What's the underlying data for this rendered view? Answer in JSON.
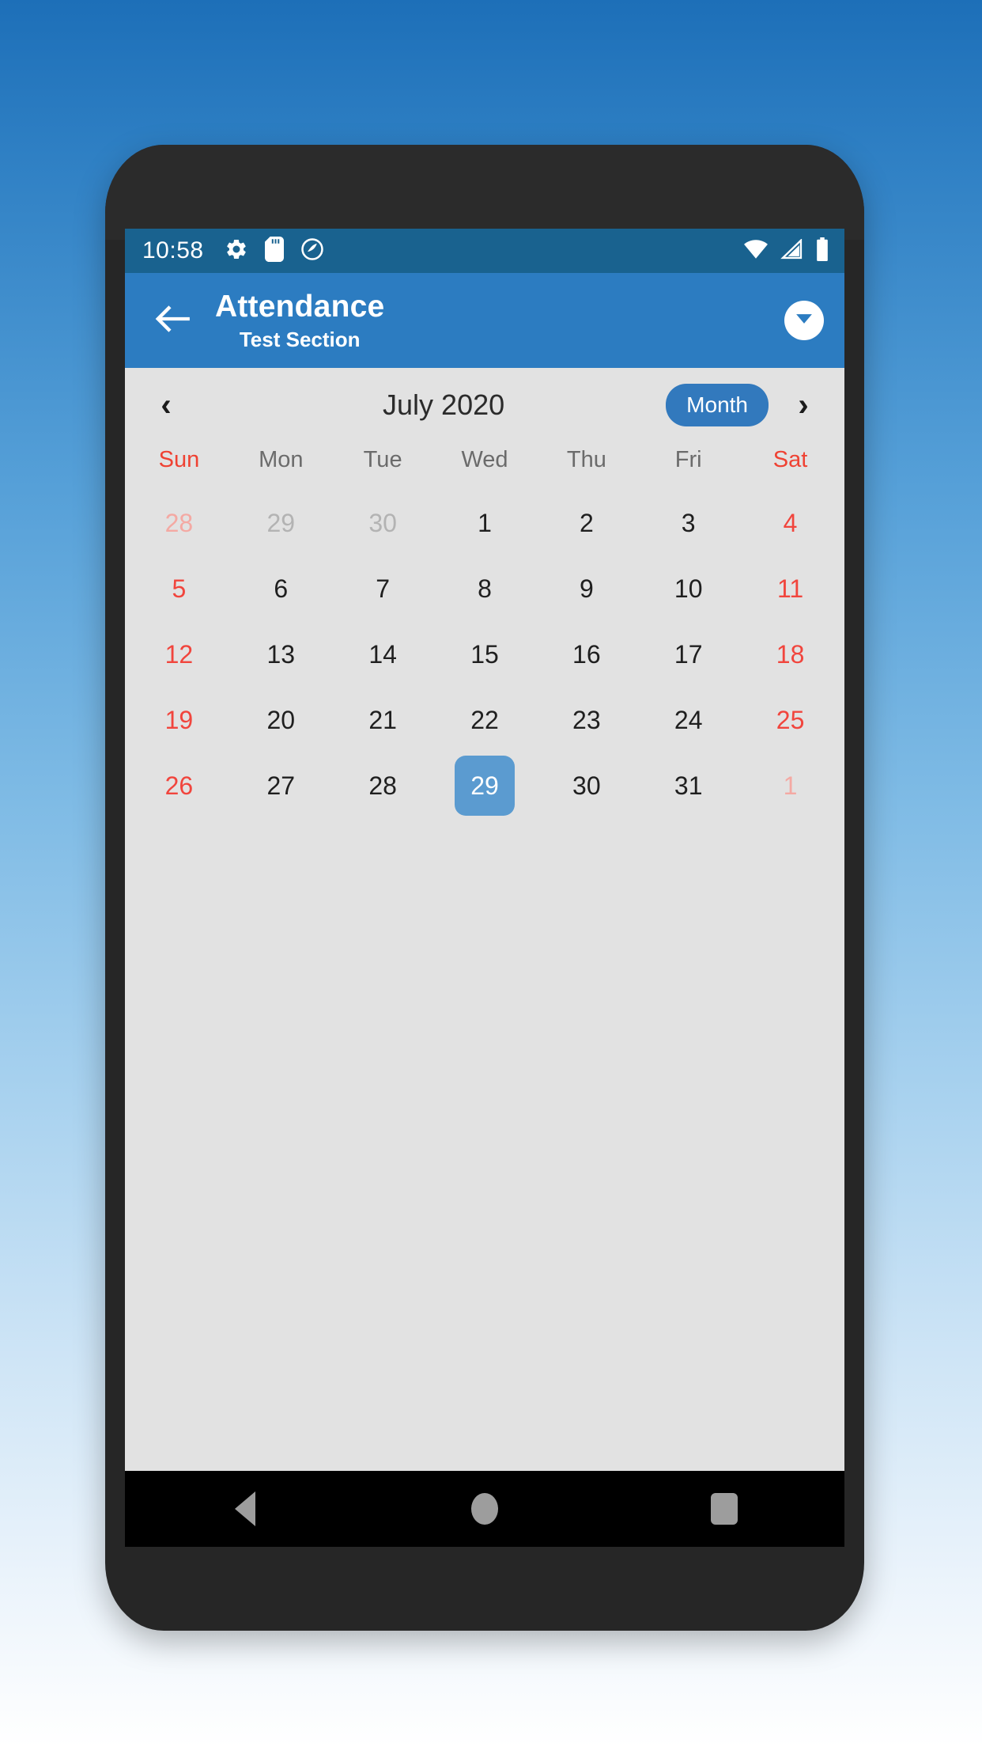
{
  "status_bar": {
    "time": "10:58",
    "left_icons": [
      "gear-icon",
      "sd-card-icon",
      "do-not-disturb-icon"
    ],
    "right_icons": [
      "wifi-icon",
      "cellular-signal-icon",
      "battery-icon"
    ],
    "background_color": "#19628f"
  },
  "app_bar": {
    "back_icon": "arrow-left-icon",
    "title": "Attendance",
    "subtitle": "Test Section",
    "dropdown_icon": "chevron-down-icon",
    "background_color": "#2c7cc1"
  },
  "calendar": {
    "prev_label": "‹",
    "next_label": "›",
    "month_label": "July 2020",
    "view_mode": "Month",
    "accent_color": "#3279bd",
    "selected_color": "#5b9bd0",
    "weekend_color": "#f1453d",
    "surface_color": "#e2e2e2",
    "weekdays": [
      {
        "label": "Sun",
        "weekend": true
      },
      {
        "label": "Mon",
        "weekend": false
      },
      {
        "label": "Tue",
        "weekend": false
      },
      {
        "label": "Wed",
        "weekend": false
      },
      {
        "label": "Thu",
        "weekend": false
      },
      {
        "label": "Fri",
        "weekend": false
      },
      {
        "label": "Sat",
        "weekend": true
      }
    ],
    "weeks": [
      [
        {
          "d": "28",
          "other": true,
          "sun": true,
          "sat": false,
          "sel": false
        },
        {
          "d": "29",
          "other": true,
          "sun": false,
          "sat": false,
          "sel": false
        },
        {
          "d": "30",
          "other": true,
          "sun": false,
          "sat": false,
          "sel": false
        },
        {
          "d": "1",
          "other": false,
          "sun": false,
          "sat": false,
          "sel": false
        },
        {
          "d": "2",
          "other": false,
          "sun": false,
          "sat": false,
          "sel": false
        },
        {
          "d": "3",
          "other": false,
          "sun": false,
          "sat": false,
          "sel": false
        },
        {
          "d": "4",
          "other": false,
          "sun": false,
          "sat": true,
          "sel": false
        }
      ],
      [
        {
          "d": "5",
          "other": false,
          "sun": true,
          "sat": false,
          "sel": false
        },
        {
          "d": "6",
          "other": false,
          "sun": false,
          "sat": false,
          "sel": false
        },
        {
          "d": "7",
          "other": false,
          "sun": false,
          "sat": false,
          "sel": false
        },
        {
          "d": "8",
          "other": false,
          "sun": false,
          "sat": false,
          "sel": false
        },
        {
          "d": "9",
          "other": false,
          "sun": false,
          "sat": false,
          "sel": false
        },
        {
          "d": "10",
          "other": false,
          "sun": false,
          "sat": false,
          "sel": false
        },
        {
          "d": "11",
          "other": false,
          "sun": false,
          "sat": true,
          "sel": false
        }
      ],
      [
        {
          "d": "12",
          "other": false,
          "sun": true,
          "sat": false,
          "sel": false
        },
        {
          "d": "13",
          "other": false,
          "sun": false,
          "sat": false,
          "sel": false
        },
        {
          "d": "14",
          "other": false,
          "sun": false,
          "sat": false,
          "sel": false
        },
        {
          "d": "15",
          "other": false,
          "sun": false,
          "sat": false,
          "sel": false
        },
        {
          "d": "16",
          "other": false,
          "sun": false,
          "sat": false,
          "sel": false
        },
        {
          "d": "17",
          "other": false,
          "sun": false,
          "sat": false,
          "sel": false
        },
        {
          "d": "18",
          "other": false,
          "sun": false,
          "sat": true,
          "sel": false
        }
      ],
      [
        {
          "d": "19",
          "other": false,
          "sun": true,
          "sat": false,
          "sel": false
        },
        {
          "d": "20",
          "other": false,
          "sun": false,
          "sat": false,
          "sel": false
        },
        {
          "d": "21",
          "other": false,
          "sun": false,
          "sat": false,
          "sel": false
        },
        {
          "d": "22",
          "other": false,
          "sun": false,
          "sat": false,
          "sel": false
        },
        {
          "d": "23",
          "other": false,
          "sun": false,
          "sat": false,
          "sel": false
        },
        {
          "d": "24",
          "other": false,
          "sun": false,
          "sat": false,
          "sel": false
        },
        {
          "d": "25",
          "other": false,
          "sun": false,
          "sat": true,
          "sel": false
        }
      ],
      [
        {
          "d": "26",
          "other": false,
          "sun": true,
          "sat": false,
          "sel": false
        },
        {
          "d": "27",
          "other": false,
          "sun": false,
          "sat": false,
          "sel": false
        },
        {
          "d": "28",
          "other": false,
          "sun": false,
          "sat": false,
          "sel": false
        },
        {
          "d": "29",
          "other": false,
          "sun": false,
          "sat": false,
          "sel": true
        },
        {
          "d": "30",
          "other": false,
          "sun": false,
          "sat": false,
          "sel": false
        },
        {
          "d": "31",
          "other": false,
          "sun": false,
          "sat": false,
          "sel": false
        },
        {
          "d": "1",
          "other": true,
          "sun": false,
          "sat": true,
          "sel": false
        }
      ]
    ]
  },
  "nav_bar": {
    "back_icon": "triangle-back-icon",
    "home_icon": "circle-home-icon",
    "recents_icon": "square-recents-icon"
  }
}
